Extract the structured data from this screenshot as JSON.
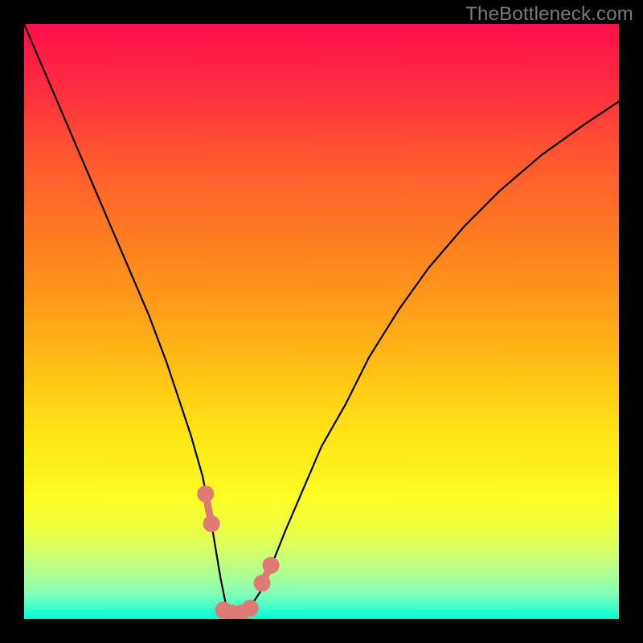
{
  "watermark": {
    "text": "TheBottleneck.com"
  },
  "colors": {
    "frame_bg": "#000000",
    "curve": "#000000",
    "marker": "#e07a74",
    "gradient_top": "#ff0e49",
    "gradient_bottom": "#00ffd0"
  },
  "chart_data": {
    "type": "line",
    "title": "",
    "xlabel": "",
    "ylabel": "",
    "xlim": [
      0,
      100
    ],
    "ylim": [
      0,
      100
    ],
    "grid": false,
    "legend": false,
    "series": [
      {
        "name": "bottleneck-curve",
        "x": [
          0,
          3,
          6,
          9,
          12,
          15,
          18,
          21,
          24,
          26,
          28,
          30,
          31,
          32,
          33,
          34,
          35,
          36,
          38,
          40,
          42,
          44,
          47,
          50,
          54,
          58,
          63,
          68,
          74,
          80,
          87,
          94,
          100
        ],
        "y": [
          100,
          93,
          86,
          79,
          72,
          65,
          58,
          51,
          43,
          37,
          31,
          24,
          19,
          13,
          7,
          2,
          1,
          1,
          2,
          5,
          10,
          15,
          22,
          29,
          36,
          44,
          52,
          59,
          66,
          72,
          78,
          83,
          87
        ]
      }
    ],
    "annotations": [
      {
        "name": "marker-cluster-left",
        "x": 30.5,
        "y": 21
      },
      {
        "name": "marker-cluster-left",
        "x": 31.5,
        "y": 16
      },
      {
        "name": "marker-cluster-right",
        "x": 40,
        "y": 6
      },
      {
        "name": "marker-cluster-right",
        "x": 41.5,
        "y": 9
      },
      {
        "name": "marker-bottom",
        "x": 33.5,
        "y": 1.5
      },
      {
        "name": "marker-bottom",
        "x": 35,
        "y": 1
      },
      {
        "name": "marker-bottom",
        "x": 36.5,
        "y": 1
      },
      {
        "name": "marker-bottom",
        "x": 38,
        "y": 1.8
      }
    ]
  }
}
